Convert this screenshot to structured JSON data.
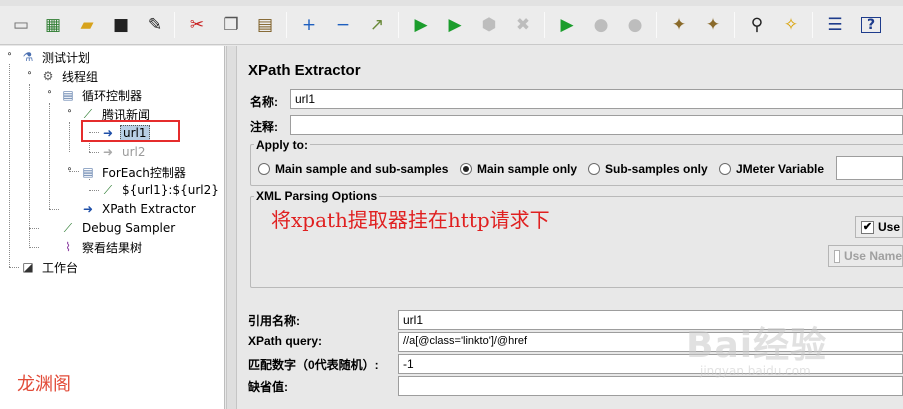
{
  "toolbar": {
    "buttons": [
      {
        "name": "new-icon",
        "glyph": "▭",
        "color": "#6f6f6f"
      },
      {
        "name": "templates-icon",
        "glyph": "▦",
        "color": "#2f7d32"
      },
      {
        "name": "open-icon",
        "glyph": "▰",
        "color": "#d7a21c"
      },
      {
        "name": "save-icon",
        "glyph": "■",
        "color": "#222"
      },
      {
        "name": "save-as-icon",
        "glyph": "✎",
        "color": "#222"
      },
      {
        "name": "cut-icon",
        "glyph": "✂",
        "color": "#c82020"
      },
      {
        "name": "copy-icon",
        "glyph": "❐",
        "color": "#555"
      },
      {
        "name": "paste-icon",
        "glyph": "▤",
        "color": "#7a5a20"
      },
      {
        "name": "expand-icon",
        "glyph": "+",
        "color": "#1e5fbf"
      },
      {
        "name": "collapse-icon",
        "glyph": "−",
        "color": "#1e5fbf"
      },
      {
        "name": "toggle-icon",
        "glyph": "↗",
        "color": "#6a8a3a"
      },
      {
        "name": "start-icon",
        "glyph": "▶",
        "color": "#1b9d2c"
      },
      {
        "name": "start-no-pause-icon",
        "glyph": "▶",
        "color": "#1b9d2c"
      },
      {
        "name": "stop-icon",
        "glyph": "⬢",
        "color": "#bdbdbd"
      },
      {
        "name": "shutdown-icon",
        "glyph": "✖",
        "color": "#bdbdbd"
      },
      {
        "name": "remote-start-icon",
        "glyph": "▶",
        "color": "#1b9d2c"
      },
      {
        "name": "remote-stop-icon",
        "glyph": "●",
        "color": "#bdbdbd"
      },
      {
        "name": "remote-shutdown-icon",
        "glyph": "●",
        "color": "#bdbdbd"
      },
      {
        "name": "clear-icon",
        "glyph": "✦",
        "color": "#8a6a2a"
      },
      {
        "name": "clear-all-icon",
        "glyph": "✦",
        "color": "#8a6a2a"
      },
      {
        "name": "search-icon",
        "glyph": "⚲",
        "color": "#222"
      },
      {
        "name": "reset-search-icon",
        "glyph": "✧",
        "color": "#d9a000"
      },
      {
        "name": "function-helper-icon",
        "glyph": "☰",
        "color": "#1e3c8c"
      },
      {
        "name": "help-icon",
        "glyph": "?",
        "color": "#1e3c8c"
      },
      {
        "name": "extra-icon",
        "glyph": "▣",
        "color": "#444"
      }
    ]
  },
  "tree": {
    "nodes": [
      {
        "label": "测试计划",
        "icon": "flask-icon",
        "glyph": "⚗",
        "color": "#4a6fb0"
      },
      {
        "label": "线程组",
        "icon": "gear-icon",
        "glyph": "⚙",
        "color": "#5a5a5a"
      },
      {
        "label": "循环控制器",
        "icon": "controller-icon",
        "glyph": "▤",
        "color": "#5a7aa8"
      },
      {
        "label": "腾讯新闻",
        "icon": "sampler-pipette-icon",
        "glyph": "⟋",
        "color": "#2e7d32"
      },
      {
        "label": "url1",
        "icon": "arrow-right-icon",
        "glyph": "➜",
        "color": "#1f4fa8"
      },
      {
        "label": "url2",
        "icon": "arrow-right-icon",
        "glyph": "➜",
        "color": "#a9a9a9"
      },
      {
        "label": "ForEach控制器",
        "icon": "controller-icon",
        "glyph": "▤",
        "color": "#5a7aa8"
      },
      {
        "label": "${url1}:${url2}",
        "icon": "sampler-pipette-icon",
        "glyph": "⟋",
        "color": "#2e7d32"
      },
      {
        "label": "XPath Extractor",
        "icon": "arrow-right-icon",
        "glyph": "➜",
        "color": "#1f4fa8"
      },
      {
        "label": "Debug Sampler",
        "icon": "sampler-pipette-icon",
        "glyph": "⟋",
        "color": "#2e7d32"
      },
      {
        "label": "察看结果树",
        "icon": "chart-icon",
        "glyph": "⌇",
        "color": "#8a3aa0"
      },
      {
        "label": "工作台",
        "icon": "workbench-icon",
        "glyph": "◪",
        "color": "#333"
      }
    ],
    "watermark": "龙渊阁"
  },
  "panel": {
    "title": "XPath Extractor",
    "name_label": "名称:",
    "name_value": "url1",
    "comment_label": "注释:",
    "comment_value": "",
    "apply_to": {
      "title": "Apply to:",
      "options": [
        {
          "label": "Main sample and sub-samples",
          "selected": false
        },
        {
          "label": "Main sample only",
          "selected": true
        },
        {
          "label": "Sub-samples only",
          "selected": false
        },
        {
          "label": "JMeter Variable",
          "selected": false
        }
      ],
      "variable_value": ""
    },
    "xml_parsing": {
      "title": "XML Parsing Options",
      "checkbox_use": {
        "label": "Use",
        "checked": true
      },
      "checkbox_use_namespaces": {
        "label": "Use Name",
        "checked": false
      }
    },
    "annotation": "将xpath提取器挂在http请求下",
    "ref_name_label": "引用名称:",
    "ref_name_value": "url1",
    "xpath_query_label": "XPath query:",
    "xpath_query_value": "//a[@class='linkto']/@href",
    "match_no_label": "匹配数字（0代表随机）:",
    "match_no_value": "-1",
    "default_label": "缺省值:",
    "default_value": ""
  },
  "baidu_watermark": {
    "brand": "Bai经验",
    "url": "jingyan.baidu.com"
  }
}
